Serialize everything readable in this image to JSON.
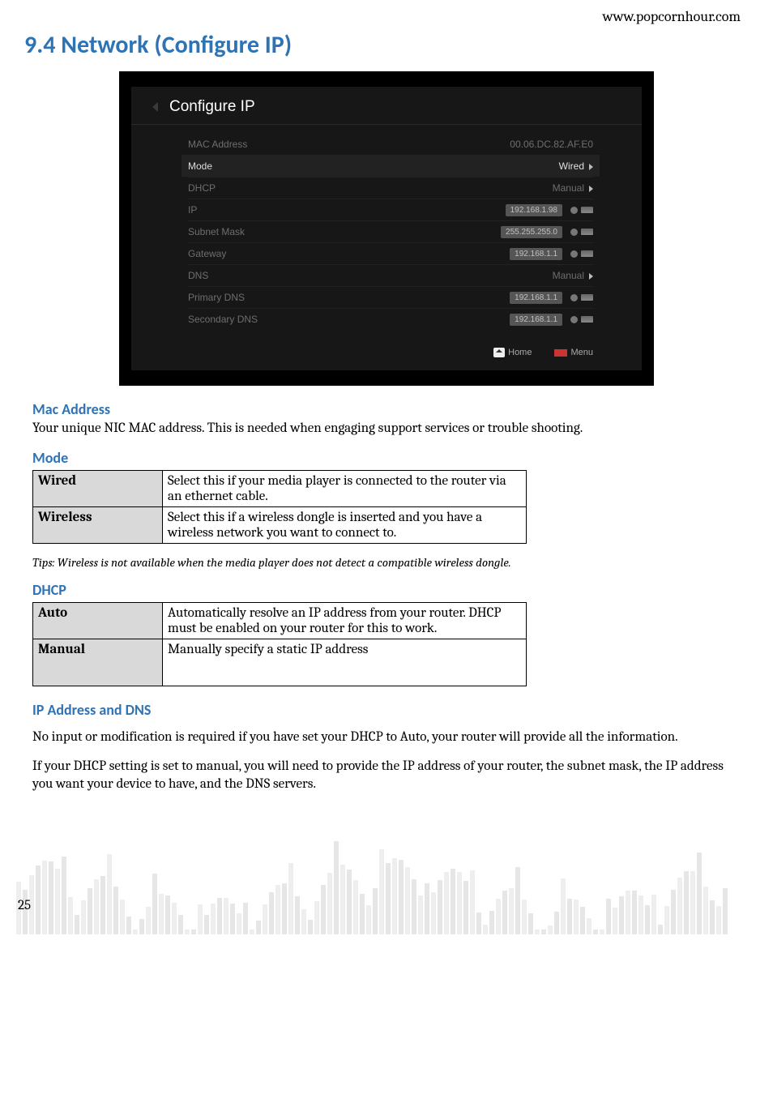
{
  "header_url": "www.popcornhour.com",
  "section_title": "9.4 Network (Configure IP)",
  "screenshot": {
    "title": "Configure IP",
    "rows": {
      "mac_label": "MAC Address",
      "mac_value": "00.06.DC.82.AF.E0",
      "mode_label": "Mode",
      "mode_value": "Wired",
      "dhcp_label": "DHCP",
      "dhcp_value": "Manual",
      "ip_label": "IP",
      "ip_value": "192.168.1.98",
      "subnet_label": "Subnet Mask",
      "subnet_value": "255.255.255.0",
      "gateway_label": "Gateway",
      "gateway_value": "192.168.1.1",
      "dns_label": "DNS",
      "dns_value": "Manual",
      "pdns_label": "Primary DNS",
      "pdns_value": "192.168.1.1",
      "sdns_label": "Secondary DNS",
      "sdns_value": "192.168.1.1"
    },
    "footer": {
      "home": "Home",
      "menu": "Menu"
    }
  },
  "mac": {
    "heading": "Mac Address",
    "text": "Your unique NIC MAC address. This is needed when engaging support services or trouble shooting."
  },
  "mode": {
    "heading": "Mode",
    "wired_k": "Wired",
    "wired_v": "Select this if your media player is connected to the router via an ethernet cable.",
    "wireless_k": "Wireless",
    "wireless_v": "Select this if a wireless dongle is inserted and you have a wireless network you want to connect to."
  },
  "tips": "Tips: Wireless is not available when the media player does not detect a compatible wireless dongle.",
  "dhcp": {
    "heading": "DHCP",
    "auto_k": "Auto",
    "auto_v": "Automatically resolve an IP address from your router. DHCP must be enabled on your router for this to work.",
    "manual_k": "Manual",
    "manual_v": "Manually specify a static IP address"
  },
  "ipdns": {
    "heading": "IP Address and DNS",
    "p1": "No input or modification is required if you have set your DHCP to Auto, your router will provide all the information.",
    "p2": "If your DHCP setting is set to manual, you will need to provide the IP address of your router, the subnet mask, the IP address you want your device to have, and the DNS servers."
  },
  "page_number": "25"
}
